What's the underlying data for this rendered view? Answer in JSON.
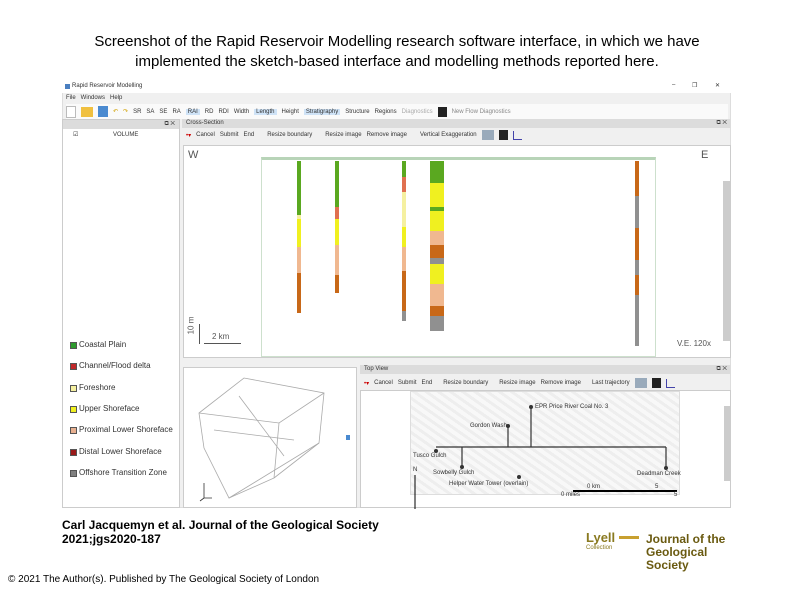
{
  "caption": {
    "line1": "Screenshot of the Rapid Reservoir Modelling research software interface, in which we have",
    "line2": "implemented the sketch-based interface and modelling methods reported here."
  },
  "app": {
    "title": "Rapid Reservoir Modelling",
    "menu": [
      "File",
      "Windows",
      "Help"
    ],
    "toolbar": [
      "SR",
      "SA",
      "SE",
      "RA",
      "RAI",
      "RD",
      "RDI",
      "Width",
      "Length",
      "Height",
      "Stratigraphy",
      "Structure",
      "Regions",
      "Diagnostics",
      "New Flow Diagnostics"
    ]
  },
  "left_panel": {
    "volume_label": "VOLUME",
    "legend": [
      {
        "label": "Coastal Plain",
        "color": "#2e9b2e"
      },
      {
        "label": "Channel/Flood delta",
        "color": "#c0282a"
      },
      {
        "label": "Foreshore",
        "color": "#f5f0a0"
      },
      {
        "label": "Upper Shoreface",
        "color": "#f0f020"
      },
      {
        "label": "Proximal Lower Shoreface",
        "color": "#e8b090"
      },
      {
        "label": "Distal Lower Shoreface",
        "color": "#9a1a1a"
      },
      {
        "label": "Offshore Transition Zone",
        "color": "#808080"
      }
    ]
  },
  "cross_section": {
    "title": "Cross-Section",
    "toolbar": [
      "Cancel",
      "Submit",
      "End",
      "Resize boundary",
      "Resize image",
      "Remove image",
      "Vertical Exaggeration"
    ],
    "west": "W",
    "east": "E",
    "vscale": "10 m",
    "hscale": "2 km",
    "ve": "V.E. 120x"
  },
  "top_view": {
    "title": "Top View",
    "toolbar": [
      "Cancel",
      "Submit",
      "End",
      "Resize boundary",
      "Resize image",
      "Remove image",
      "Last trajectory"
    ],
    "labels": {
      "well1": "EPR Price River Coal No. 3",
      "well2": "Gordon Wash",
      "well3": "Tusco Gulch",
      "well4": "Sowbelly Gulch",
      "well5": "Helper Water Tower (overlain)",
      "well6": "Deadman Creek",
      "north": "N",
      "scale_km": "0 km",
      "scale_km_end": "5",
      "scale_mi": "0 miles",
      "scale_mi_end": "5"
    }
  },
  "citation": {
    "line1": "Carl Jacquemyn et al. Journal of the Geological Society",
    "line2": "2021;jgs2020-187"
  },
  "copyright": "© 2021 The Author(s). Published by The Geological Society of London",
  "logo": {
    "lyell": "Lyell",
    "collection": "Collection",
    "journal": "Journal of the Geological Society"
  }
}
